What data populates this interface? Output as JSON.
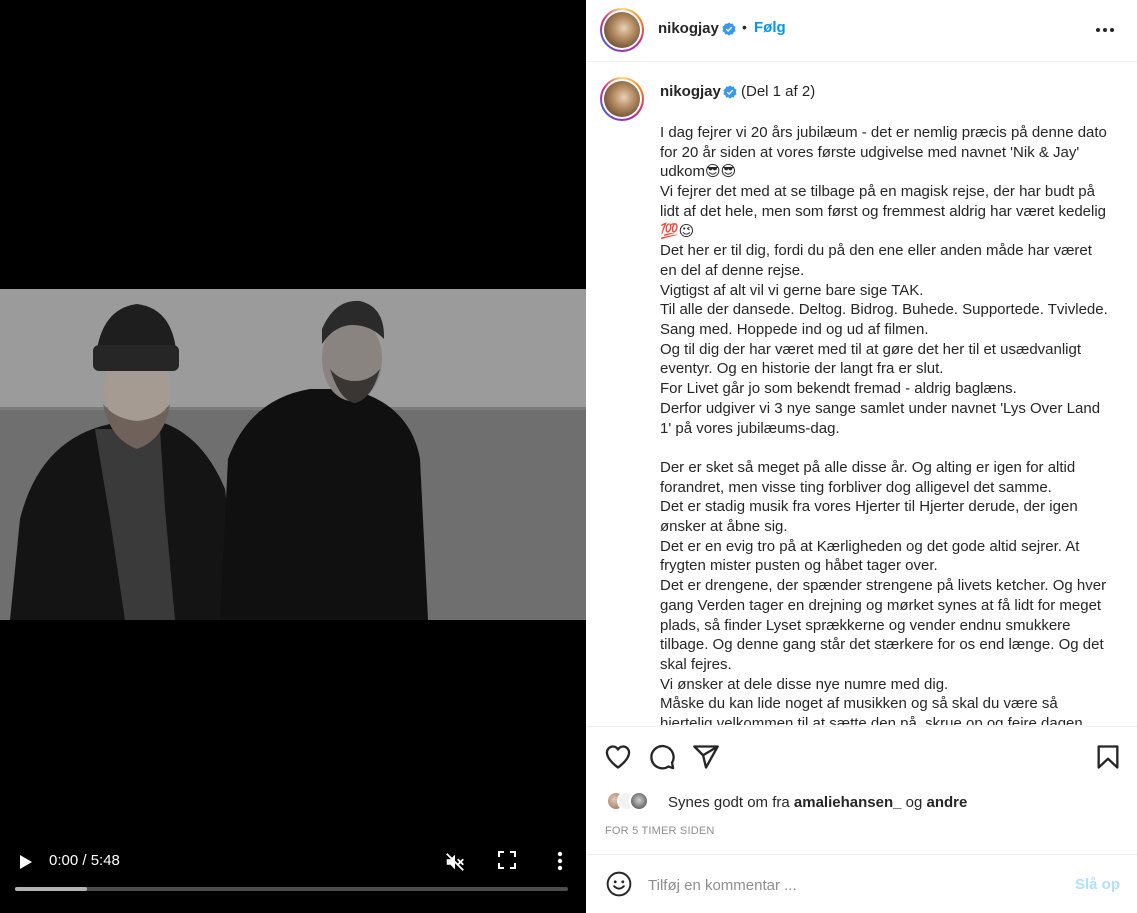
{
  "video": {
    "time": "0:00 / 5:48",
    "progress_buffered": 0.13,
    "icons": {
      "play": "play-icon",
      "mute": "volume-muted-icon",
      "fullscreen": "fullscreen-icon",
      "more": "more-vertical-icon"
    }
  },
  "header": {
    "username": "nikogjay",
    "dot": "•",
    "follow_label": "Følg"
  },
  "caption": {
    "username": "nikogjay",
    "part_label": "(Del 1 af 2)",
    "lines": [
      "I dag fejrer vi 20 års jubilæum - det er nemlig præcis på denne dato for 20 år siden at vores første udgivelse med navnet 'Nik & Jay' udkom😎😎",
      "Vi fejrer det med at se tilbage på en magisk rejse, der har budt på lidt af det hele, men som først og fremmest aldrig har været kedelig 💯😉",
      "Det her er til dig, fordi du på den ene eller anden måde har været en del af denne rejse.",
      "Vigtigst af alt vil vi gerne bare sige TAK.",
      "Til alle der dansede. Deltog. Bidrog. Buhede. Supportede. Tvivlede. Sang med. Hoppede ind og ud af filmen.",
      "Og til dig der har været med til at gøre det her til et usædvanligt eventyr. Og en historie der langt fra er slut.",
      "For Livet går jo som bekendt fremad - aldrig baglæns.",
      "Derfor udgiver vi 3 nye sange samlet under navnet 'Lys Over Land 1' på vores jubilæums-dag.",
      "",
      "Der er sket så meget på alle disse år. Og alting er igen for altid forandret, men visse ting forbliver dog alligevel det samme.",
      "Det er stadig musik fra vores Hjerter til Hjerter derude, der igen ønsker at åbne sig.",
      "Det er en evig tro på at Kærligheden og det gode altid sejrer. At frygten mister pusten og håbet tager over.",
      "Det er drengene, der spænder strengene på livets ketcher. Og hver gang Verden tager en drejning og mørket synes at få lidt for meget plads, så finder Lyset sprækkerne og vender endnu smukkere tilbage. Og denne gang står det stærkere for os end længe. Og det skal fejres.",
      "Vi ønsker at dele disse nye numre med dig.",
      "Måske du kan lide noget af musikken og så skal du være så hjertelig velkommen til at sætte den på, skrue op og fejre dagen"
    ]
  },
  "actions": {
    "icons": [
      "heart-icon",
      "comment-icon",
      "share-icon",
      "bookmark-icon"
    ]
  },
  "likes": {
    "prefix": "Synes godt om fra",
    "first_user": "amaliehansen_",
    "connector": "og",
    "others": "andre"
  },
  "timestamp": "FOR 5 TIMER SIDEN",
  "comment": {
    "placeholder": "Tilføj en kommentar ...",
    "post_label": "Slå op"
  },
  "colors": {
    "accent": "#0095f6",
    "post_disabled": "#b2dffc",
    "verified": "#3897f0",
    "muted_text": "#8e8e8e"
  }
}
